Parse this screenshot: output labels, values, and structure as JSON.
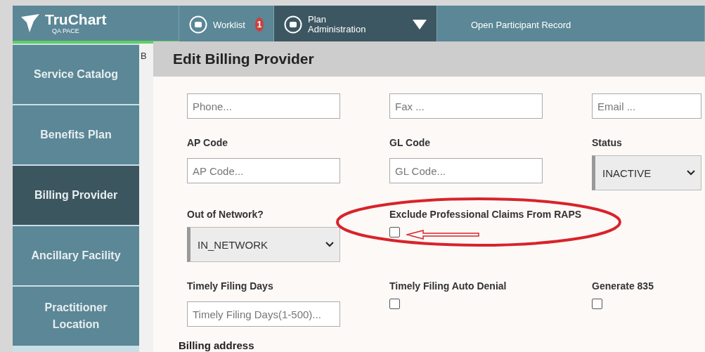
{
  "header": {
    "logo": {
      "name": "TruChart",
      "subtitle": "QA PACE"
    },
    "nav": [
      {
        "label": "Worklist",
        "badge": "1",
        "selected": false,
        "dropdown": false
      },
      {
        "label": "Plan Administration",
        "selected": true,
        "dropdown": true
      },
      {
        "label": "Open Participant Record",
        "selected": false,
        "dropdown": false
      }
    ]
  },
  "sidebar": {
    "items": [
      {
        "label": "Service Catalog",
        "selected": false
      },
      {
        "label": "Benefits Plan",
        "selected": false
      },
      {
        "label": "Billing Provider",
        "selected": true
      },
      {
        "label": "Ancillary Facility",
        "selected": false
      },
      {
        "label": "Practitioner Location",
        "selected": false
      }
    ]
  },
  "background_page": {
    "heading": "B"
  },
  "modal": {
    "title": "Edit Billing Provider",
    "fields": [
      {
        "kind": "input",
        "placeholder": "Phone..."
      },
      {
        "kind": "input",
        "placeholder": "Fax ..."
      },
      {
        "kind": "input",
        "placeholder": "Email ..."
      },
      {
        "kind": "input",
        "label": "AP Code",
        "placeholder": "AP Code..."
      },
      {
        "kind": "input",
        "label": "GL Code",
        "placeholder": "GL Code..."
      },
      {
        "kind": "select",
        "label": "Status",
        "value": "INACTIVE"
      },
      {
        "kind": "select",
        "label": "Out of Network?",
        "value": "IN_NETWORK"
      },
      {
        "kind": "checkbox",
        "label": "Exclude Professional Claims From RAPS",
        "checked": false,
        "highlighted": true
      },
      {
        "kind": "empty"
      },
      {
        "kind": "input",
        "label": "Timely Filing Days",
        "placeholder": "Timely Filing Days(1-500)..."
      },
      {
        "kind": "checkbox",
        "label": "Timely Filing Auto Denial",
        "checked": false
      },
      {
        "kind": "checkbox",
        "label": "Generate 835",
        "checked": false
      }
    ],
    "section": "Billing address"
  }
}
